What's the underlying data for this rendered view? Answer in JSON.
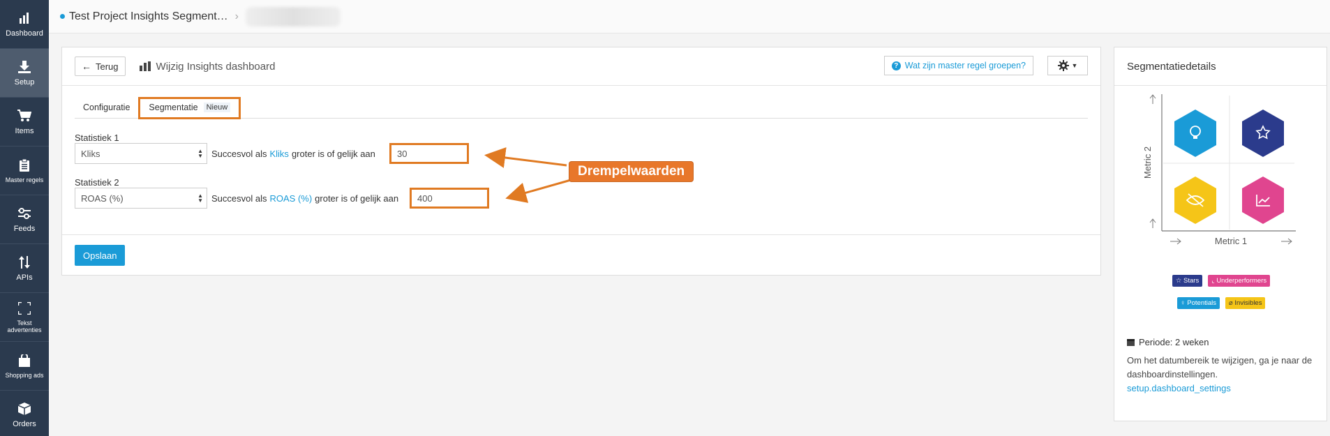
{
  "sidebar": {
    "items": [
      {
        "label": "Dashboard",
        "icon": "bar-chart-icon"
      },
      {
        "label": "Setup",
        "icon": "download-icon",
        "active": true
      },
      {
        "label": "Items",
        "icon": "cart-icon"
      },
      {
        "label": "Master regels",
        "icon": "clipboard-icon"
      },
      {
        "label": "Feeds",
        "icon": "sliders-icon"
      },
      {
        "label": "APIs",
        "icon": "arrows-updown-icon"
      },
      {
        "label": "Tekst advertenties",
        "icon": "text-frame-icon"
      },
      {
        "label": "Shopping ads",
        "icon": "shopping-bag-icon"
      },
      {
        "label": "Orders",
        "icon": "box-icon"
      }
    ]
  },
  "topbar": {
    "project": "Test Project Insights Segment…",
    "separator": "›"
  },
  "panel": {
    "back_label": "Terug",
    "title": "Wijzig Insights dashboard",
    "help_label": "Wat zijn master regel groepen?",
    "tabs": [
      {
        "label": "Configuratie"
      },
      {
        "label": "Segmentatie",
        "badge": "Nieuw"
      }
    ],
    "stat1": {
      "label": "Statistiek 1",
      "select": "Kliks",
      "prefix": "Succesvol als",
      "keyword": "Kliks",
      "suffix": "groter is of gelijk aan",
      "value": "30"
    },
    "stat2": {
      "label": "Statistiek 2",
      "select": "ROAS (%)",
      "prefix": "Succesvol als",
      "keyword": "ROAS (%)",
      "suffix": "groter is of gelijk aan",
      "value": "400"
    },
    "save_label": "Opslaan"
  },
  "callout": {
    "label": "Drempelwaarden",
    "color": "#e8772a"
  },
  "details": {
    "title": "Segmentatiedetails",
    "metric1": "Metric 1",
    "metric2": "Metric 2",
    "legend": [
      {
        "label": "Stars",
        "color": "#2b3b8c",
        "icon": "star-icon"
      },
      {
        "label": "Underperformers",
        "color": "#e0458f",
        "icon": "chart-icon"
      },
      {
        "label": "Potentials",
        "color": "#1a9bd7",
        "icon": "bulb-icon"
      },
      {
        "label": "Invisibles",
        "color": "#f5c518",
        "icon": "eye-slash-icon"
      }
    ],
    "period": "Periode: 2 weken",
    "period_desc": "Om het datumbereik te wijzigen, ga je naar de dashboardinstellingen.",
    "period_link": "setup.dashboard_settings"
  },
  "colors": {
    "accent": "#1a9bd7",
    "highlight": "#e07a22",
    "sidebar": "#2b3a4e"
  }
}
